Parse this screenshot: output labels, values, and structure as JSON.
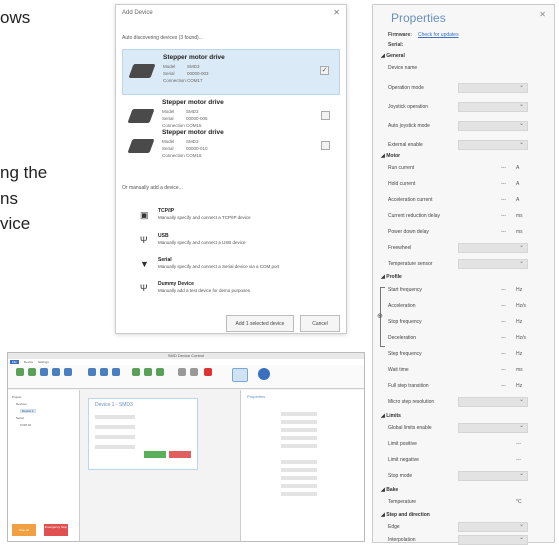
{
  "background_text": [
    "ows",
    "ng the",
    "ns",
    "vice"
  ],
  "dialog": {
    "title": "Add Device",
    "status": "Auto discovering devices (3 found)...",
    "devices": [
      {
        "name": "Stepper motor drive",
        "model_label": "Model",
        "model": "SMD3",
        "serial_label": "Serial",
        "serial": "00000-003",
        "conn_label": "Connection",
        "connection": "COM17",
        "selected": true
      },
      {
        "name": "Stepper motor drive",
        "model_label": "Model",
        "model": "SMD3",
        "serial_label": "Serial",
        "serial": "00000-005",
        "conn_label": "Connection",
        "connection": "COM15",
        "selected": false
      },
      {
        "name": "Stepper motor drive",
        "model_label": "Model",
        "model": "SMD3",
        "serial_label": "Serial",
        "serial": "00000-010",
        "conn_label": "Connection",
        "connection": "COM18",
        "selected": false
      }
    ],
    "manual_header": "Or manually add a device...",
    "options": [
      {
        "icon": "network-icon",
        "name": "TCP/IP",
        "desc": "Manually specify and connect a TCP/IP device"
      },
      {
        "icon": "usb-icon",
        "name": "USB",
        "desc": "Manually specify and connect a USB device"
      },
      {
        "icon": "serial-icon",
        "name": "Serial",
        "desc": "Manually specify and connect a Serial device via a COM port"
      },
      {
        "icon": "dummy-icon",
        "name": "Dummy Device",
        "desc": "Manually add a test device for demo purposes"
      }
    ],
    "add_button": "Add 1 selected device",
    "cancel_button": "Cancel"
  },
  "properties": {
    "title": "Properties",
    "firmware_label": "Firmware:",
    "firmware_link": "Check for updates",
    "serial_label": "Serial:",
    "sections": {
      "general": "General",
      "motor": "Motor",
      "profile": "Profile",
      "limits": "Limits",
      "bake": "Bake",
      "step": "Step and direction"
    },
    "general": [
      "Device name",
      "Operation mode",
      "Joystick operation",
      "Auto joystick mode",
      "External enable"
    ],
    "motor": [
      "Run current",
      "Hold current",
      "Acceleration current",
      "Current reduction delay",
      "Power down delay",
      "Freewheel",
      "Temperature sensor"
    ],
    "motor_units": [
      "A",
      "A",
      "A",
      "ms",
      "ms"
    ],
    "profile": [
      "Start frequency",
      "Acceleration",
      "Stop frequency",
      "Deceleration",
      "Step frequency",
      "Wait time",
      "Full step transition",
      "Micro step resolution"
    ],
    "profile_units": [
      "Hz",
      "Hz/s",
      "Hz",
      "Hz/s",
      "Hz",
      "ms",
      "Hz"
    ],
    "limits": [
      "Global limits enable",
      "Limit positive",
      "Limit negative",
      "Stop mode"
    ],
    "bake": [
      "Temperature"
    ],
    "bake_unit": "°C",
    "step": [
      "Edge",
      "Interpolation"
    ],
    "dash": "---"
  },
  "app": {
    "title": "SMD Device Control",
    "menu": [
      "File",
      "Device",
      "Settings"
    ],
    "device_tab": "Device 1 - SMD3",
    "tree": [
      "Project",
      "Devices",
      "Device 1",
      "Serial",
      "COM 16"
    ],
    "bottom_buttons": [
      "Stop all",
      "Emergency Stop"
    ]
  }
}
